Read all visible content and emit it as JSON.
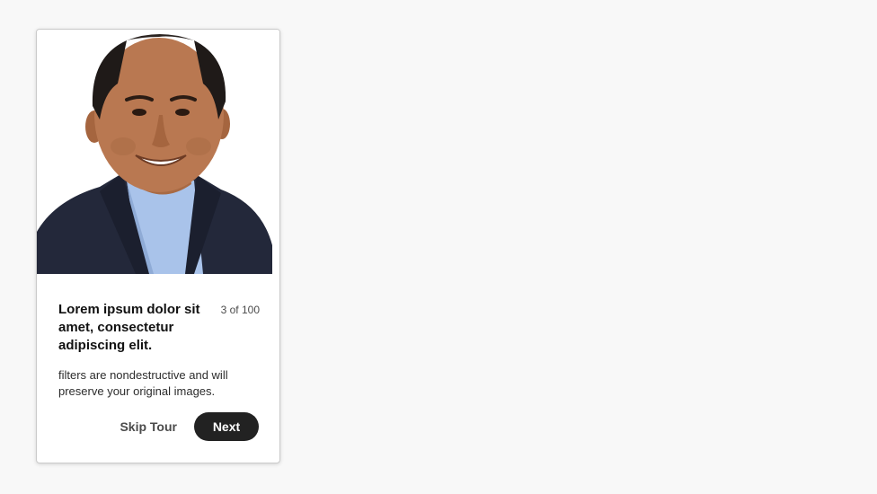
{
  "coachmark": {
    "image_alt": "Portrait photo of a smiling man in a dark blazer",
    "title": "Lorem ipsum dolor sit amet, consectetur adipiscing elit.",
    "step": "3 of 100",
    "description": "filters are nondestructive and will preserve your original images.",
    "skip_label": "Skip Tour",
    "next_label": "Next"
  },
  "colors": {
    "page_bg": "#f8f8f8",
    "card_bg": "#ffffff",
    "primary_button_bg": "#222222",
    "primary_button_text": "#ffffff"
  }
}
